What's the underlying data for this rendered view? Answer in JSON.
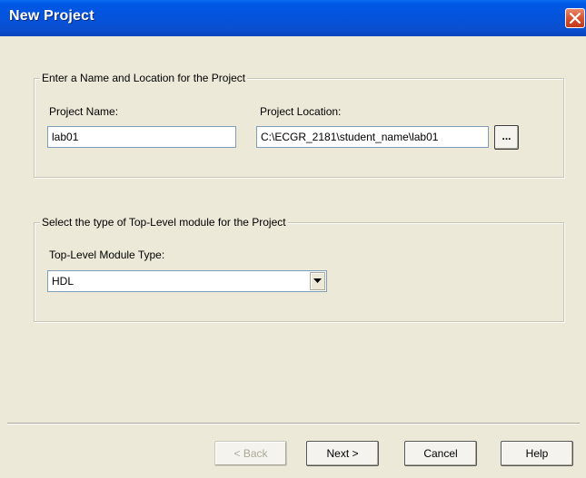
{
  "window": {
    "title": "New Project",
    "close_icon": "close-icon"
  },
  "name_location_group": {
    "legend": "Enter a Name and Location for the Project",
    "project_name_label": "Project Name:",
    "project_name_value": "lab01",
    "project_location_label": "Project Location:",
    "project_location_value": "C:\\ECGR_2181\\student_name\\lab01",
    "browse_label": "..."
  },
  "module_type_group": {
    "legend": "Select the type of Top-Level module for the Project",
    "module_type_label": "Top-Level Module Type:",
    "module_type_value": "HDL"
  },
  "buttons": {
    "back_label": "< Back",
    "next_label": "Next >",
    "cancel_label": "Cancel",
    "help_label": "Help"
  },
  "colors": {
    "titlebar": "#0453dd",
    "close_button": "#d9512e",
    "dialog_background": "#ece9d8"
  }
}
